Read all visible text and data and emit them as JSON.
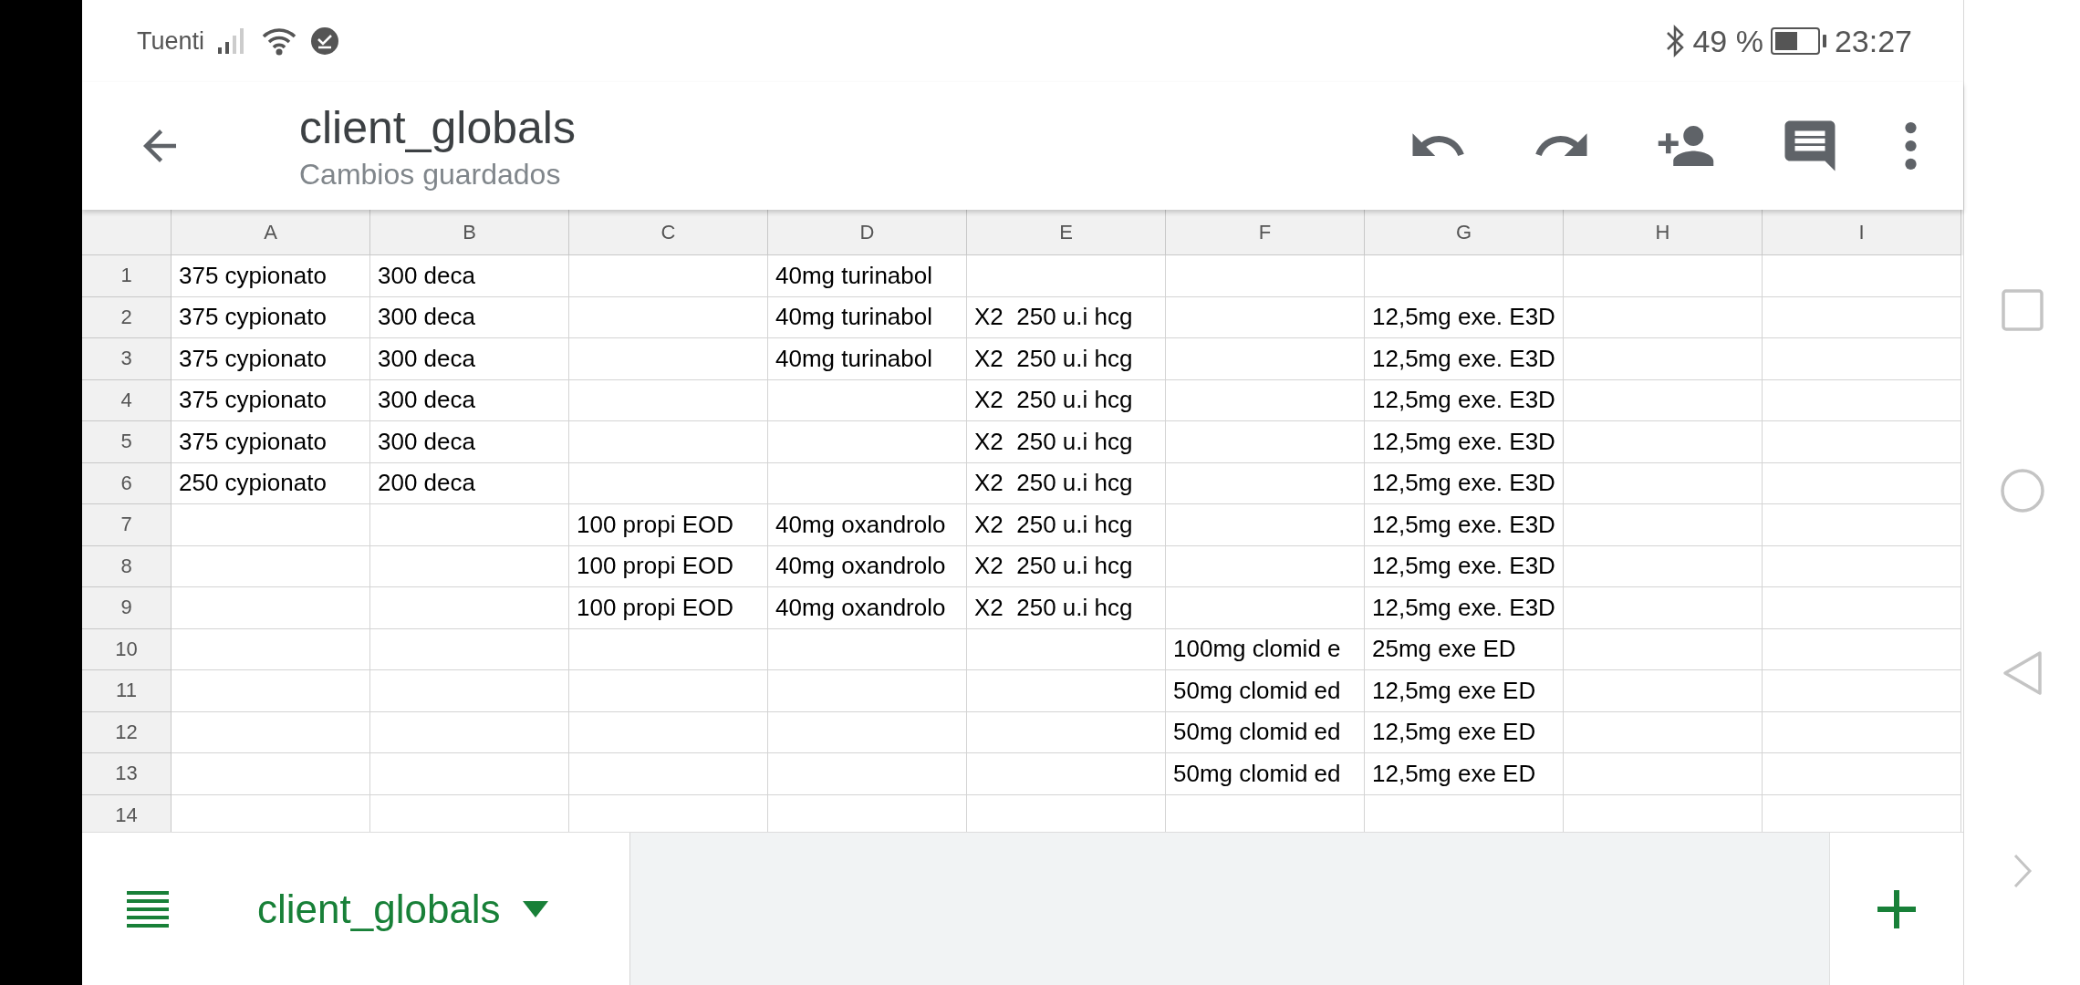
{
  "status_bar": {
    "carrier": "Tuenti",
    "battery": "49 %",
    "time": "23:27"
  },
  "toolbar": {
    "title": "client_globals",
    "subtitle": "Cambios guardados"
  },
  "sheet": {
    "columns": [
      "A",
      "B",
      "C",
      "D",
      "E",
      "F",
      "G",
      "H",
      "I"
    ],
    "rows": [
      {
        "number": "1",
        "cells": {
          "A": "375 cypionato",
          "B": "300 deca",
          "D": "40mg turinabol"
        }
      },
      {
        "number": "2",
        "cells": {
          "A": "375 cypionato",
          "B": "300 deca",
          "D": "40mg turinabol",
          "E": "X2  250 u.i hcg",
          "G": "12,5mg exe. E3D"
        }
      },
      {
        "number": "3",
        "cells": {
          "A": "375 cypionato",
          "B": "300 deca",
          "D": "40mg turinabol",
          "E": "X2  250 u.i hcg",
          "G": "12,5mg exe. E3D"
        }
      },
      {
        "number": "4",
        "cells": {
          "A": "375 cypionato",
          "B": "300 deca",
          "E": "X2  250 u.i hcg",
          "G": "12,5mg exe. E3D"
        }
      },
      {
        "number": "5",
        "cells": {
          "A": "375 cypionato",
          "B": "300 deca",
          "E": "X2  250 u.i hcg",
          "G": "12,5mg exe. E3D"
        }
      },
      {
        "number": "6",
        "cells": {
          "A": "250 cypionato",
          "B": "200 deca",
          "E": "X2  250 u.i hcg",
          "G": "12,5mg exe. E3D"
        }
      },
      {
        "number": "7",
        "cells": {
          "C": "100 propi EOD",
          "D": "40mg oxandrolo",
          "E": "X2  250 u.i hcg",
          "G": "12,5mg exe. E3D"
        }
      },
      {
        "number": "8",
        "cells": {
          "C": "100 propi EOD",
          "D": "40mg oxandrolo",
          "E": "X2  250 u.i hcg",
          "G": "12,5mg exe. E3D"
        }
      },
      {
        "number": "9",
        "cells": {
          "C": "100 propi EOD",
          "D": "40mg oxandrolo",
          "E": "X2  250 u.i hcg",
          "G": "12,5mg exe. E3D"
        }
      },
      {
        "number": "10",
        "cells": {
          "F": "100mg clomid e",
          "G": "25mg exe ED"
        }
      },
      {
        "number": "11",
        "cells": {
          "F": "50mg clomid ed",
          "G": "12,5mg exe ED"
        }
      },
      {
        "number": "12",
        "cells": {
          "F": "50mg clomid ed",
          "G": "12,5mg exe ED"
        }
      },
      {
        "number": "13",
        "cells": {
          "F": "50mg clomid ed",
          "G": "12,5mg exe ED"
        }
      },
      {
        "number": "14"
      }
    ]
  },
  "sheet_tabs": [
    {
      "label": "client_globals",
      "selected": true
    }
  ]
}
